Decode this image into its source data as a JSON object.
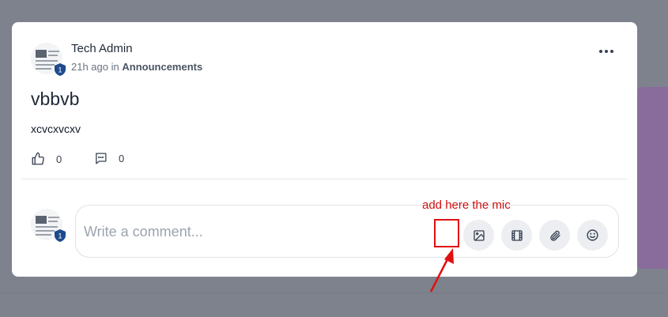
{
  "post": {
    "author": "Tech Admin",
    "time": "21h ago",
    "in_word": "in",
    "category": "Announcements",
    "title": "vbbvb",
    "body": "xcvcxvcxv",
    "likes": "0",
    "comments": "0",
    "avatar_badge": "1"
  },
  "comment": {
    "placeholder": "Write a comment...",
    "avatar_badge": "1"
  },
  "annotation": {
    "text": "add here the mic",
    "color": "#e01010"
  },
  "icons": [
    "more-horizontal-icon",
    "thumbs-up-icon",
    "comment-icon",
    "image-icon",
    "video-icon",
    "paperclip-icon",
    "smile-icon",
    "shield-badge-icon"
  ]
}
